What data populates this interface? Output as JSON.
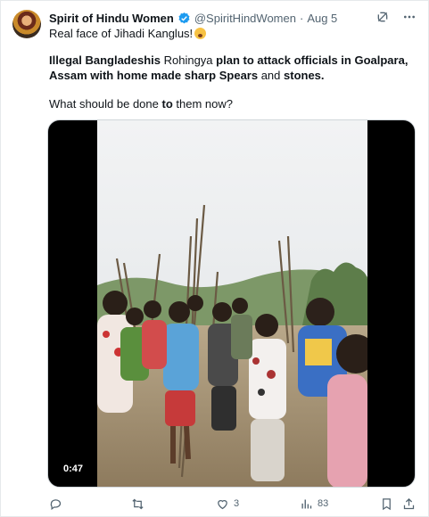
{
  "tweet": {
    "display_name": "Spirit of Hindu Women",
    "handle": "@SpiritHindWomen",
    "separator": "·",
    "date": "Aug 5",
    "line1": "Real face of Jihadi Kanglus!",
    "body_parts": [
      {
        "text": "Illegal Bangladeshis",
        "bold": true
      },
      {
        "text": " Rohingya ",
        "bold": false
      },
      {
        "text": "plan to attack officials in Goalpara, Assam with home made sharp Spears",
        "bold": true
      },
      {
        "text": " and ",
        "bold": false
      },
      {
        "text": "stones.",
        "bold": true
      }
    ],
    "question_parts": [
      {
        "text": "What should be done ",
        "bold": false
      },
      {
        "text": "to",
        "bold": true
      },
      {
        "text": " them now?",
        "bold": false
      }
    ]
  },
  "media": {
    "duration": "0:47"
  },
  "actions": {
    "reply_count": "",
    "retweet_count": "",
    "like_count": "3",
    "views_count": "83"
  },
  "icons": [
    "grok-icon",
    "more-icon",
    "reply-icon",
    "retweet-icon",
    "like-icon",
    "views-icon",
    "bookmark-icon",
    "share-icon"
  ],
  "colors": {
    "text": "#0f1419",
    "secondary": "#536471",
    "verified": "#1d9bf0"
  }
}
